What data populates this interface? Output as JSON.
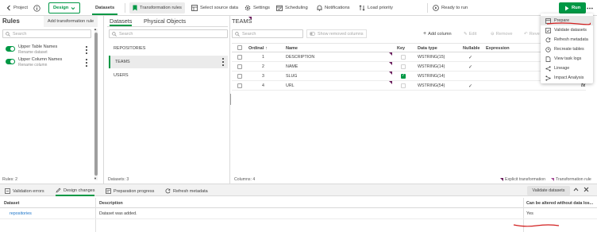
{
  "topbar": {
    "project_label": "Project",
    "design_label": "Design",
    "datasets_tab": "Datasets",
    "transformation_rules": "Transformation rules",
    "select_source_data": "Select source data",
    "settings": "Settings",
    "scheduling": "Scheduling",
    "notifications": "Notifications",
    "load_priority": "Load priority",
    "status": "Ready to run",
    "run_label": "Run"
  },
  "rules_panel": {
    "title": "Rules",
    "add_rule": "Add transformation rule",
    "search_placeholder": "Search",
    "rules": [
      {
        "title": "Upper Table Names",
        "subtitle": "Rename dataset"
      },
      {
        "title": "Upper Column Names",
        "subtitle": "Rename column"
      }
    ],
    "footer": "Rules: 2"
  },
  "datasets_panel": {
    "tab_datasets": "Datasets",
    "tab_physical": "Physical Objects",
    "search_placeholder": "Search",
    "items": [
      "REPOSITORIES",
      "TEAMS",
      "USERS"
    ],
    "footer": "Datasets: 3"
  },
  "columns_panel": {
    "title": "TEAMS",
    "search_placeholder": "Search",
    "show_removed": "Show removed columns",
    "add_column": "Add column",
    "edit": "Edit",
    "remove": "Remove",
    "revert": "Reve",
    "headers": {
      "ordinal": "Ordinal",
      "name": "Name",
      "key": "Key",
      "datatype": "Data type",
      "nullable": "Nullable",
      "expression": "Expression"
    },
    "rows": [
      {
        "ordinal": "1",
        "name": "DESCRIPTION",
        "key": false,
        "datatype": "WSTRING(15)",
        "nullable": true
      },
      {
        "ordinal": "2",
        "name": "NAME",
        "key": false,
        "datatype": "WSTRING(14)",
        "nullable": true
      },
      {
        "ordinal": "3",
        "name": "SLUG",
        "key": true,
        "datatype": "WSTRING(14)",
        "nullable": false
      },
      {
        "ordinal": "4",
        "name": "URL",
        "key": false,
        "datatype": "WSTRING(54)",
        "nullable": true
      }
    ],
    "footer": "Columns: 4",
    "legend_explicit": "Explicit transformation",
    "legend_rule": "Transformation rule"
  },
  "more_menu": {
    "items": [
      "Prepare",
      "Validate datasets",
      "Refresh metadata",
      "Recreate tables",
      "View task logs",
      "Lineage",
      "Impact Analysis"
    ]
  },
  "bottom": {
    "tabs": [
      "Validation errors",
      "Design changes",
      "Preparation progress",
      "Refresh metadata"
    ],
    "validate_button": "Validate datasets",
    "headers": {
      "dataset": "Dataset",
      "description": "Description",
      "altered": "Can be altered without data los..."
    },
    "rows": [
      {
        "dataset": "repositories",
        "description": "Dataset was added.",
        "altered": "Yes"
      }
    ]
  },
  "colors": {
    "accent": "#009845",
    "marker": "#6a1c5c",
    "annotation": "#d21f1f"
  }
}
